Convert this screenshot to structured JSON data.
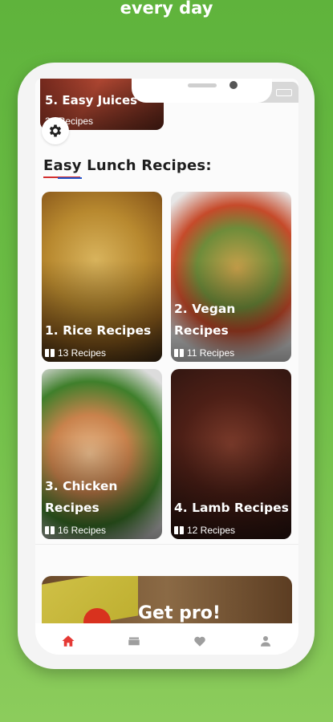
{
  "promo": {
    "caption": "every day"
  },
  "juice_card": {
    "title": "5. Easy Juices",
    "count": "20 Recipes"
  },
  "section": {
    "title": "Easy Lunch Recipes:"
  },
  "cards": [
    {
      "title": "1. Rice Recipes",
      "count": "13 Recipes"
    },
    {
      "title": "2. Vegan Recipes",
      "count": "11 Recipes"
    },
    {
      "title": "3. Chicken Recipes",
      "count": "16 Recipes"
    },
    {
      "title": "4. Lamb Recipes",
      "count": "12 Recipes"
    }
  ],
  "pro_banner": {
    "text": "Get pro!"
  },
  "bottom_nav": [
    {
      "icon": "home-icon",
      "active": true
    },
    {
      "icon": "wallet-icon",
      "active": false
    },
    {
      "icon": "heart-icon",
      "active": false
    },
    {
      "icon": "person-icon",
      "active": false
    }
  ],
  "colors": {
    "background_green": "#6cbd45",
    "active_red": "#e53935",
    "inactive_grey": "#9e9e9e"
  }
}
